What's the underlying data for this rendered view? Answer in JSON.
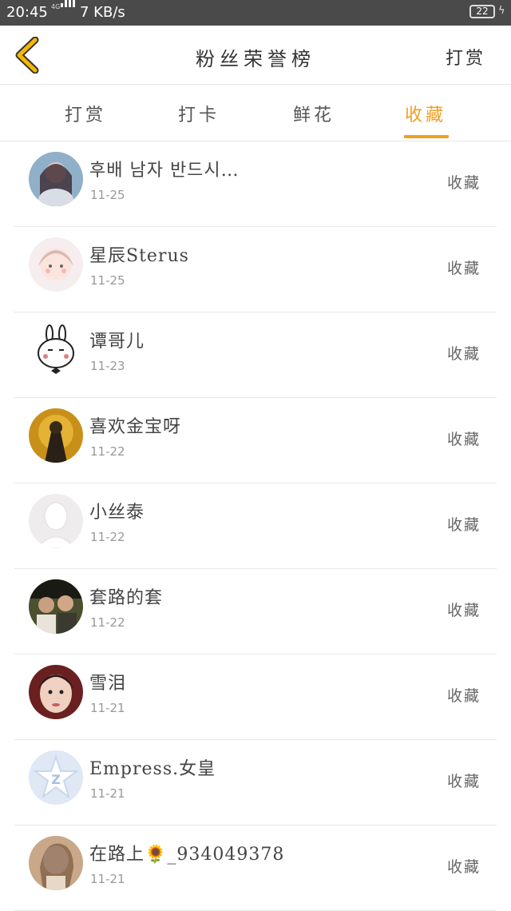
{
  "status_bar": {
    "time": "20:45",
    "network": "4G",
    "speed": "7 KB/s",
    "battery": "22"
  },
  "header": {
    "title": "粉丝荣誉榜",
    "action_label": "打赏"
  },
  "tabs": [
    {
      "label": "打赏",
      "active": false
    },
    {
      "label": "打卡",
      "active": false
    },
    {
      "label": "鲜花",
      "active": false
    },
    {
      "label": "收藏",
      "active": true
    }
  ],
  "accent_color": "#f0a020",
  "list": [
    {
      "name": "후배 남자 반드시…",
      "date": "11-25",
      "action": "收藏"
    },
    {
      "name": "星辰Sterus",
      "date": "11-25",
      "action": "收藏"
    },
    {
      "name": "谭哥儿",
      "date": "11-23",
      "action": "收藏"
    },
    {
      "name": "喜欢金宝呀",
      "date": "11-22",
      "action": "收藏"
    },
    {
      "name": "小丝泰",
      "date": "11-22",
      "action": "收藏"
    },
    {
      "name": "套路的套",
      "date": "11-22",
      "action": "收藏"
    },
    {
      "name": "雪泪",
      "date": "11-21",
      "action": "收藏"
    },
    {
      "name": "Empress.女皇",
      "date": "11-21",
      "action": "收藏"
    },
    {
      "name": "在路上🌻_934049378",
      "date": "11-21",
      "action": "收藏"
    }
  ]
}
